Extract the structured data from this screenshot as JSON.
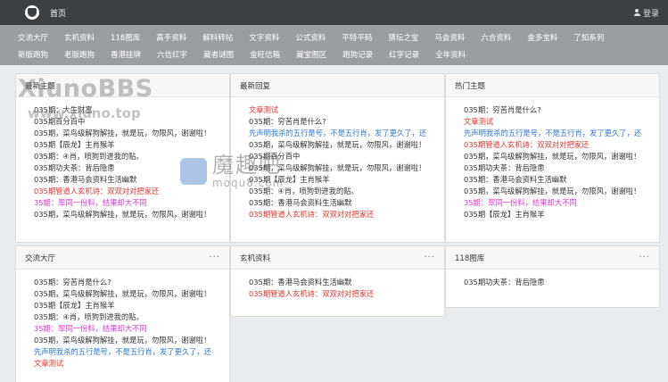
{
  "header": {
    "home": "首页",
    "login": "登录"
  },
  "nav": {
    "row1": [
      "交流大厅",
      "玄机资料",
      "118图库",
      "高手资料",
      "解料转帖",
      "文字资料",
      "公式资料",
      "平特平码",
      "猜坛之宝",
      "马会资料",
      "六合资料",
      "金多宝料",
      "了知系列"
    ],
    "row2": [
      "新版跑狗",
      "老版跑狗",
      "香港挂牌",
      "六信红字",
      "藏者谜图",
      "金旺信箱",
      "藏宝图区",
      "跑狗记录",
      "红字记录",
      "全年资料"
    ]
  },
  "panels": {
    "latest": {
      "title": "最新主题",
      "more": "",
      "items": [
        {
          "text": "035期：大生财富",
          "color": "default"
        },
        {
          "text": "035期百分百中",
          "color": "default"
        },
        {
          "text": "035期，菜鸟级解狗解挂，就是玩，勿限风，谢谢啦！",
          "color": "default"
        },
        {
          "text": "035期【辰龙】主肖猴羊",
          "color": "default"
        },
        {
          "text": "035期：④肖，喷狗到进我的贴。",
          "color": "default"
        },
        {
          "text": "035期功夫茶：背后隐患",
          "color": "default"
        },
        {
          "text": "035期：香港马会资料生活幽默",
          "color": "default"
        },
        {
          "text": "035期管道人玄机诗：双双对对把家还",
          "color": "red"
        },
        {
          "text": "35期：翠同一份料，结果却大不同",
          "color": "pink"
        },
        {
          "text": "035期，菜鸟级解狗解挂，就是玩，勿限风，谢谢啦！",
          "color": "default"
        }
      ]
    },
    "reply": {
      "title": "最新回复",
      "items": [
        {
          "text": "文章测试",
          "color": "red"
        },
        {
          "text": "035期：穷苦肖是什么?",
          "color": "default"
        },
        {
          "text": "先声明我杀的五行是号，不是五行肖，发了更久了，还",
          "color": "blue"
        },
        {
          "text": "035期，菜鸟级解狗解挂，就是玩，勿限风，谢谢啦！",
          "color": "default"
        },
        {
          "text": "035期百分百中",
          "color": "default"
        },
        {
          "text": "035期，菜鸟级解狗解挂，就是玩，勿限风，谢谢啦！",
          "color": "default"
        },
        {
          "text": "035期【辰龙】主肖猴羊",
          "color": "default"
        },
        {
          "text": "035期：④肖，喷狗到进我的贴。",
          "color": "default"
        },
        {
          "text": "035期：香港马会资料生活幽默",
          "color": "default"
        },
        {
          "text": "035期管道人玄机诗：双双对对把家还",
          "color": "red"
        }
      ]
    },
    "hot": {
      "title": "热门主题",
      "items": [
        {
          "text": "035期：穷苦肖是什么?",
          "color": "default"
        },
        {
          "text": "文章测试",
          "color": "red"
        },
        {
          "text": "先声明我杀的五行是号，不是五行肖，发了更久了，还",
          "color": "blue"
        },
        {
          "text": "035期管道人玄机诗：双双对对把家还",
          "color": "red"
        },
        {
          "text": "035期，菜鸟级解狗解挂，就是玩，勿限风，谢谢啦！",
          "color": "default"
        },
        {
          "text": "035期功夫茶：背后隐患",
          "color": "default"
        },
        {
          "text": "035期：香港马会资料生活幽默",
          "color": "default"
        },
        {
          "text": "035期，菜鸟级解狗解挂，就是玩，勿限风，谢谢啦！",
          "color": "default"
        },
        {
          "text": "35期：翠同一份料，结果却大不同",
          "color": "pink"
        },
        {
          "text": "035期【辰龙】主肖猴羊",
          "color": "default"
        }
      ]
    },
    "hall": {
      "title": "交流大厅",
      "more": "···",
      "items": [
        {
          "text": "035期：穷苦肖是什么?",
          "color": "default"
        },
        {
          "text": "035期，菜鸟级解狗解挂，就是玩，勿限风，谢谢啦！",
          "color": "default"
        },
        {
          "text": "035期【辰龙】主肖猴羊",
          "color": "default"
        },
        {
          "text": "035期：④肖，喷狗到进我的贴。",
          "color": "default"
        },
        {
          "text": "35期：翠同一份料，结果却大不同",
          "color": "pink"
        },
        {
          "text": "035期，菜鸟级解狗解挂，就是玩，勿限风，谢谢啦！",
          "color": "default"
        },
        {
          "text": "先声明我杀的五行是号，不是五行肖，发了更久了，还",
          "color": "blue"
        },
        {
          "text": "文章测试",
          "color": "red"
        }
      ]
    },
    "xuanji": {
      "title": "玄机资料",
      "more": "···",
      "items": [
        {
          "text": "035期：香港马会资料生活幽默",
          "color": "default"
        },
        {
          "text": "035期管道人玄机诗：双双对对把家还",
          "color": "red"
        }
      ]
    },
    "tuku": {
      "title": "118图库",
      "more": "···",
      "items": [
        {
          "text": "035期功夫茶：背后隐患",
          "color": "default"
        }
      ]
    }
  },
  "watermarks": {
    "line1": "XiunoBBS",
    "line2": "www.xiuno.top",
    "cn": "魔趣吧",
    "en": "moqu8.com"
  }
}
